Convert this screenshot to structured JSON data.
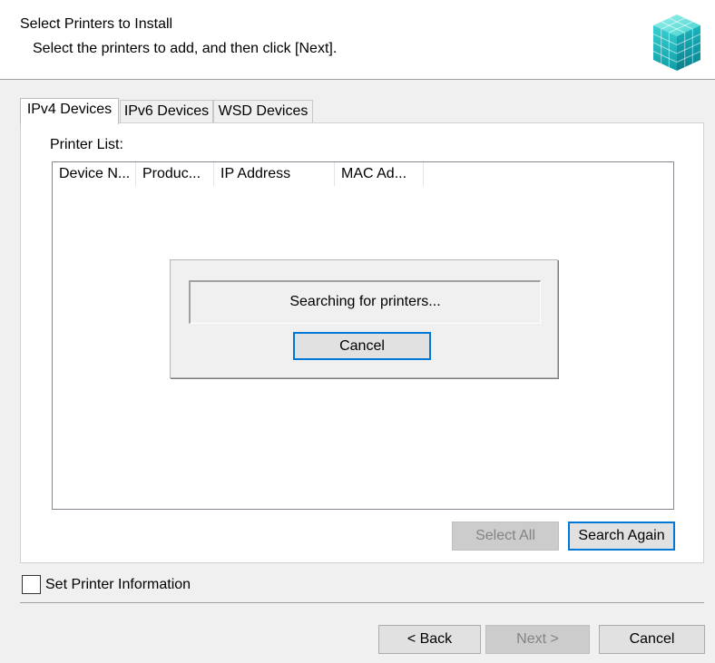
{
  "header": {
    "title": "Select Printers to Install",
    "subtitle": "Select the printers to add, and then click [Next].",
    "logo_icon": "printer-cube-icon"
  },
  "tabs": [
    {
      "label": "IPv4 Devices",
      "active": true
    },
    {
      "label": "IPv6 Devices",
      "active": false
    },
    {
      "label": "WSD Devices",
      "active": false
    }
  ],
  "printer_list": {
    "label": "Printer List:",
    "columns": [
      "Device N...",
      "Produc...",
      "IP Address",
      "MAC Ad..."
    ]
  },
  "search_dialog": {
    "status": "Searching for printers...",
    "cancel_label": "Cancel"
  },
  "list_buttons": {
    "select_all": "Select All",
    "search_again": "Search Again"
  },
  "set_printer_info": {
    "label": "Set Printer Information",
    "checked": false
  },
  "footer": {
    "back": "< Back",
    "next": "Next >",
    "cancel": "Cancel"
  },
  "colors": {
    "focus_accent": "#0078d7",
    "logo_teal": "#22c4c4"
  }
}
